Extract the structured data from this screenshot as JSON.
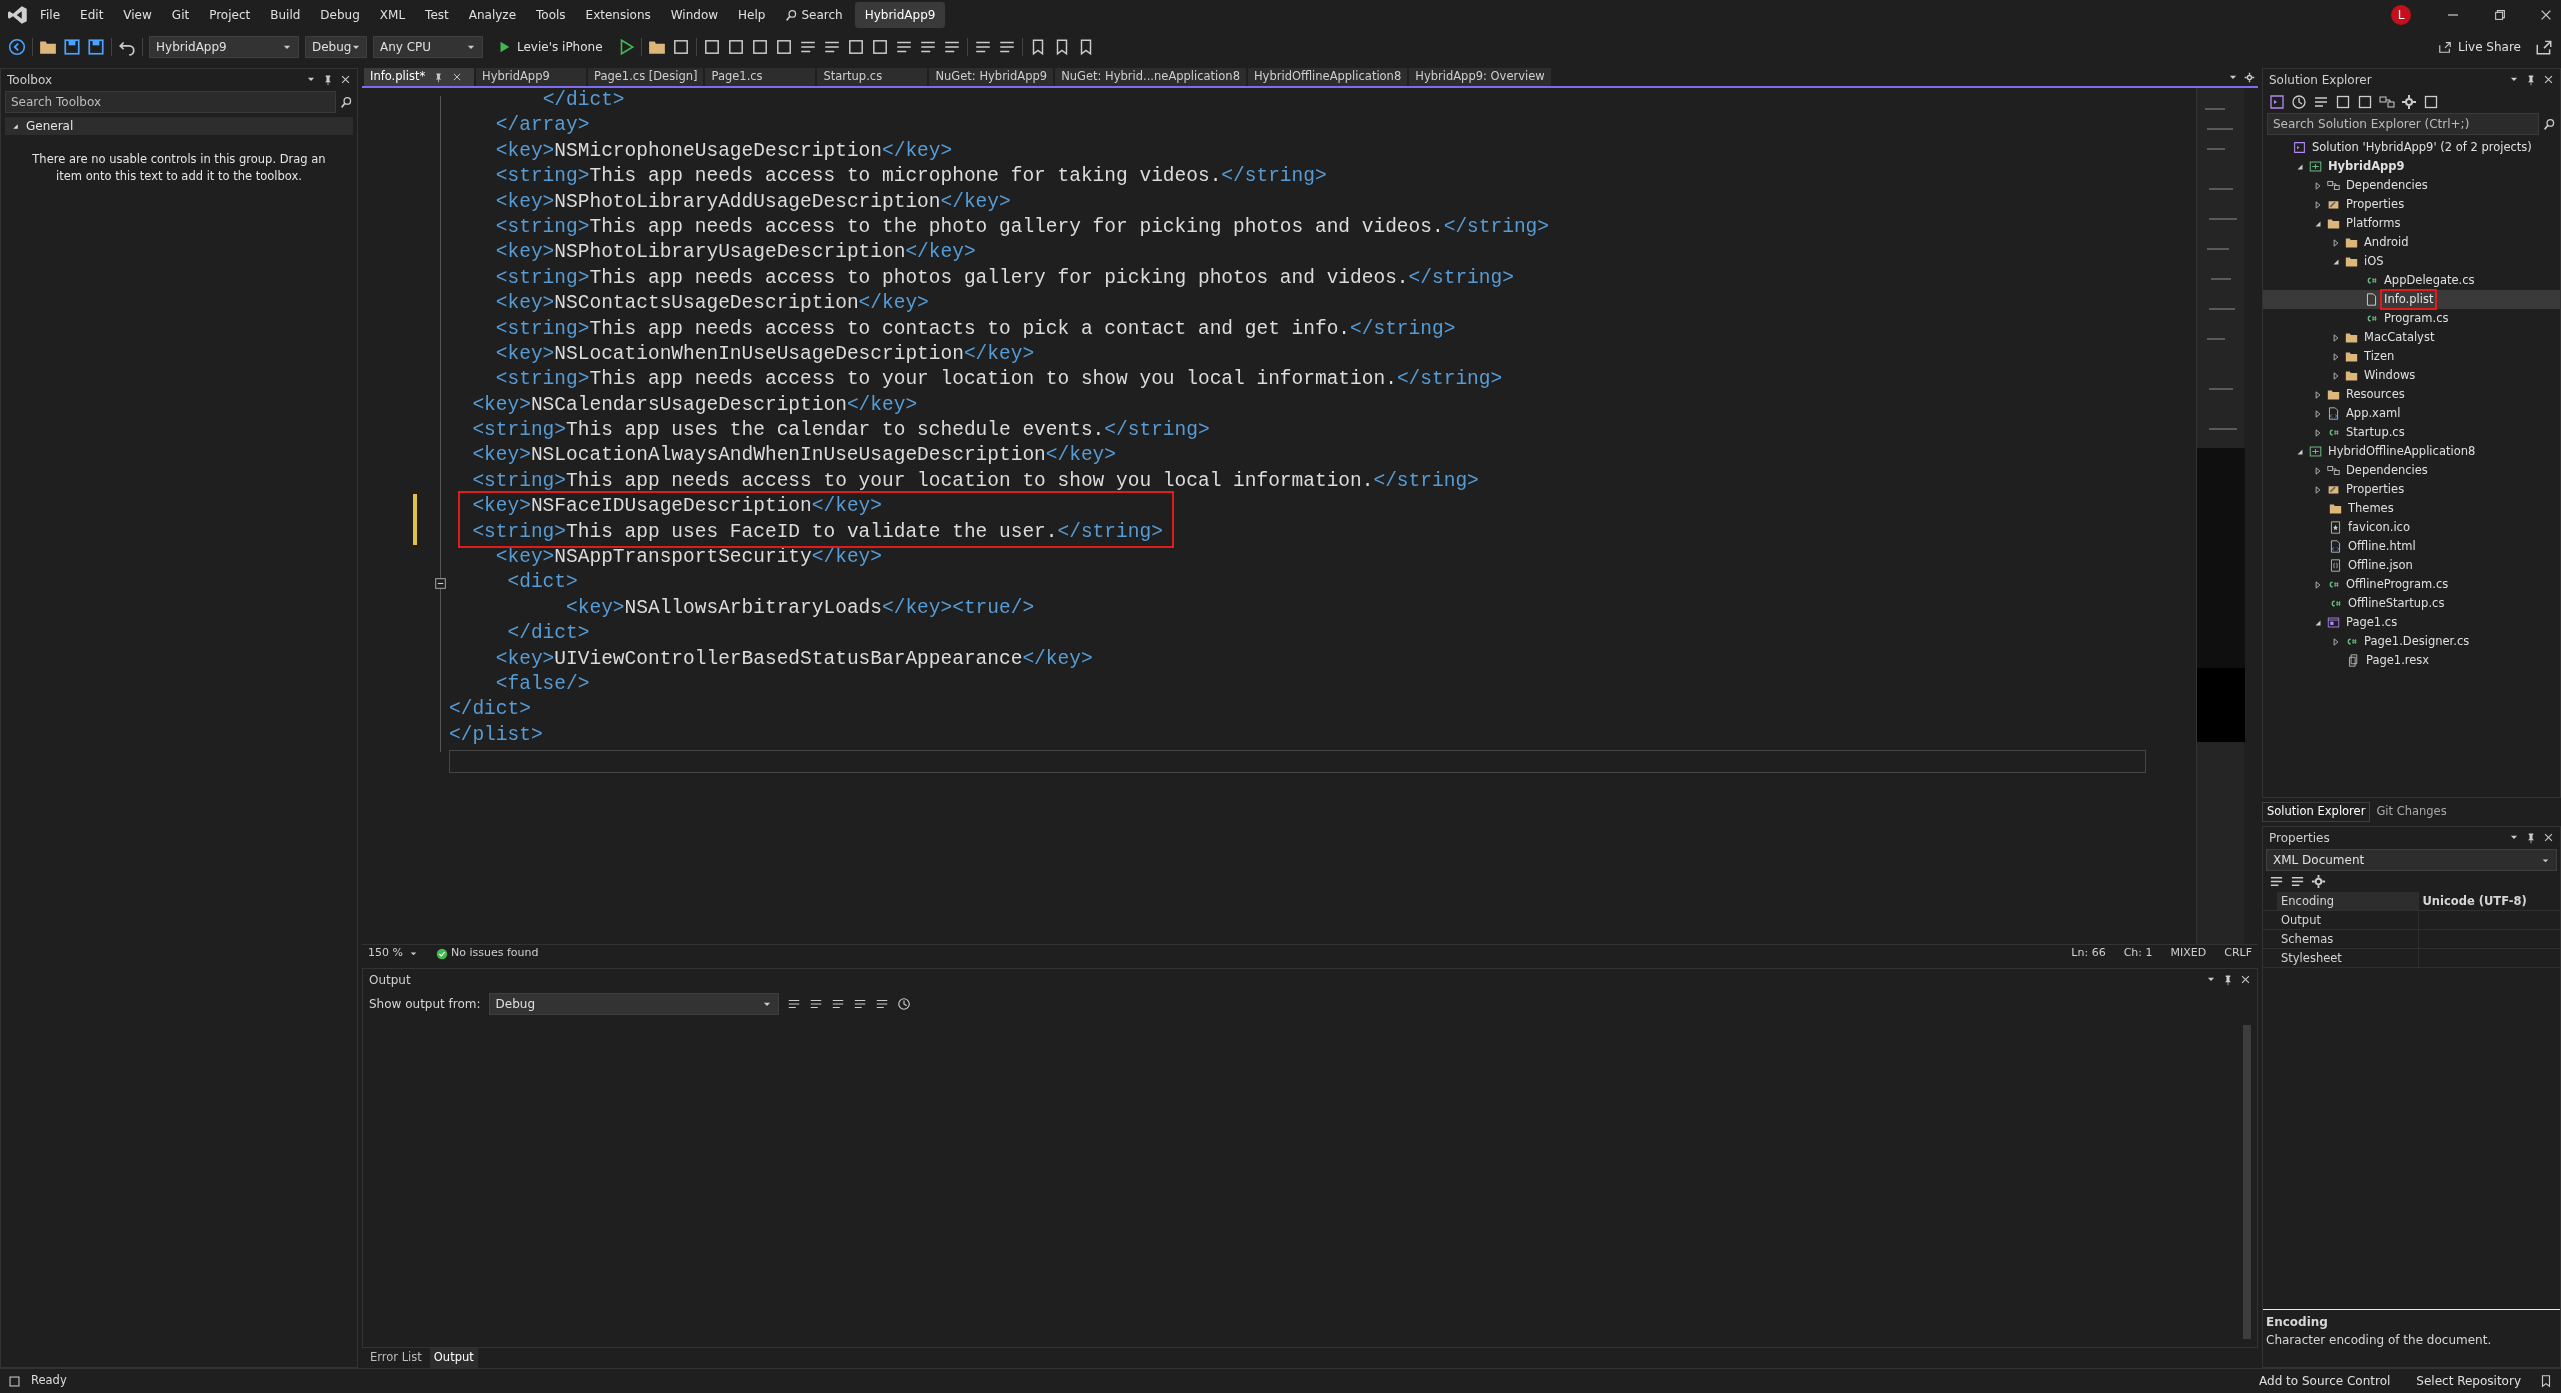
{
  "menu": {
    "items": [
      "File",
      "Edit",
      "View",
      "Git",
      "Project",
      "Build",
      "Debug",
      "XML",
      "Test",
      "Analyze",
      "Tools",
      "Extensions",
      "Window",
      "Help"
    ],
    "search": "Search",
    "solution_title": "HybridApp9",
    "avatar": "L"
  },
  "toolbar": {
    "project": "HybridApp9",
    "configuration": "Debug",
    "platform": "Any CPU",
    "run_target": "Levie's iPhone",
    "live_share": "Live Share"
  },
  "toolbox": {
    "title": "Toolbox",
    "search_placeholder": "Search Toolbox",
    "group": "General",
    "group_expanded": true,
    "empty_message": "There are no usable controls in this group. Drag an item onto this text to add it to the toolbox."
  },
  "tabs": [
    {
      "label": "Info.plist*",
      "selected": true
    },
    {
      "label": "HybridApp9",
      "selected": false
    },
    {
      "label": "Page1.cs [Design]",
      "selected": false
    },
    {
      "label": "Page1.cs",
      "selected": false
    },
    {
      "label": "Startup.cs",
      "selected": false
    },
    {
      "label": "NuGet: HybridApp9",
      "selected": false
    },
    {
      "label": "NuGet: Hybrid...neApplication8",
      "selected": false
    },
    {
      "label": "HybridOfflineApplication8",
      "selected": false
    },
    {
      "label": "HybridApp9: Overview",
      "selected": false
    }
  ],
  "editor": {
    "lines": [
      {
        "text": "        </dict>"
      },
      {
        "text": "    </array>"
      },
      {
        "text": "    <key>NSMicrophoneUsageDescription</key>"
      },
      {
        "text": "    <string>This app needs access to microphone for taking videos.</string>"
      },
      {
        "text": "    <key>NSPhotoLibraryAddUsageDescription</key>"
      },
      {
        "text": "    <string>This app needs access to the photo gallery for picking photos and videos.</string>"
      },
      {
        "text": "    <key>NSPhotoLibraryUsageDescription</key>"
      },
      {
        "text": "    <string>This app needs access to photos gallery for picking photos and videos.</string>"
      },
      {
        "text": "    <key>NSContactsUsageDescription</key>"
      },
      {
        "text": "    <string>This app needs access to contacts to pick a contact and get info.</string>"
      },
      {
        "text": "    <key>NSLocationWhenInUseUsageDescription</key>"
      },
      {
        "text": "    <string>This app needs access to your location to show you local information.</string>"
      },
      {
        "text": "  <key>NSCalendarsUsageDescription</key>"
      },
      {
        "text": "  <string>This app uses the calendar to schedule events.</string>"
      },
      {
        "text": "  <key>NSLocationAlwaysAndWhenInUseUsageDescription</key>"
      },
      {
        "text": "  <string>This app needs access to your location to show you local information.</string>"
      },
      {
        "text": "  <key>NSFaceIDUsageDescription</key>",
        "modified": true,
        "highlighted": true
      },
      {
        "text": "  <string>This app uses FaceID to validate the user.</string>",
        "modified": true,
        "highlighted": true
      },
      {
        "text": "    <key>NSAppTransportSecurity</key>"
      },
      {
        "text": "     <dict>",
        "foldable": true
      },
      {
        "text": "          <key>NSAllowsArbitraryLoads</key><true/>"
      },
      {
        "text": "     </dict>"
      },
      {
        "text": "    <key>UIViewControllerBasedStatusBarAppearance</key>"
      },
      {
        "text": "    <false/>"
      },
      {
        "text": "</dict>"
      },
      {
        "text": "</plist>"
      }
    ],
    "zoom": "150 %",
    "issues": "No issues found",
    "line": "Ln: 66",
    "column": "Ch: 1",
    "whitespace": "MIXED",
    "line_endings": "CRLF"
  },
  "output": {
    "title": "Output",
    "source_label": "Show output from:",
    "source": "Debug"
  },
  "bottom_tabs": [
    {
      "label": "Error List",
      "selected": false
    },
    {
      "label": "Output",
      "selected": true
    }
  ],
  "solution_explorer": {
    "title": "Solution Explorer",
    "search_placeholder": "Search Solution Explorer (Ctrl+;)",
    "tree": [
      {
        "label": "Solution 'HybridApp9' (2 of 2 projects)",
        "kind": "solution",
        "selected": false,
        "children": [
          {
            "label": "HybridApp9",
            "kind": "project",
            "startup": true,
            "expanded": true,
            "selected": false,
            "children": [
              {
                "label": "Dependencies",
                "kind": "dependencies",
                "expanded": false,
                "selected": false
              },
              {
                "label": "Properties",
                "kind": "properties",
                "expanded": false,
                "selected": false
              },
              {
                "label": "Platforms",
                "kind": "folder",
                "expanded": true,
                "selected": false,
                "children": [
                  {
                    "label": "Android",
                    "kind": "folder",
                    "expanded": false,
                    "selected": false
                  },
                  {
                    "label": "iOS",
                    "kind": "folder",
                    "expanded": true,
                    "selected": false,
                    "children": [
                      {
                        "label": "AppDelegate.cs",
                        "kind": "csharp",
                        "selected": false
                      },
                      {
                        "label": "Info.plist",
                        "kind": "file",
                        "selected": true,
                        "highlighted": true
                      },
                      {
                        "label": "Program.cs",
                        "kind": "csharp",
                        "selected": false
                      }
                    ]
                  },
                  {
                    "label": "MacCatalyst",
                    "kind": "folder",
                    "expanded": false,
                    "selected": false
                  },
                  {
                    "label": "Tizen",
                    "kind": "folder",
                    "expanded": false,
                    "selected": false
                  },
                  {
                    "label": "Windows",
                    "kind": "folder",
                    "expanded": false,
                    "selected": false
                  }
                ]
              },
              {
                "label": "Resources",
                "kind": "folder",
                "expanded": false,
                "selected": false
              },
              {
                "label": "App.xaml",
                "kind": "markup",
                "expanded": false,
                "selected": false
              },
              {
                "label": "Startup.cs",
                "kind": "csharp",
                "expanded": false,
                "selected": false
              }
            ]
          },
          {
            "label": "HybridOfflineApplication8",
            "kind": "project",
            "startup": false,
            "expanded": true,
            "selected": false,
            "children": [
              {
                "label": "Dependencies",
                "kind": "dependencies",
                "expanded": false,
                "selected": false
              },
              {
                "label": "Properties",
                "kind": "properties",
                "expanded": false,
                "selected": false
              },
              {
                "label": "Themes",
                "kind": "folder",
                "selected": false
              },
              {
                "label": "favicon.ico",
                "kind": "image",
                "selected": false
              },
              {
                "label": "Offline.html",
                "kind": "markup",
                "selected": false
              },
              {
                "label": "Offline.json",
                "kind": "json",
                "selected": false
              },
              {
                "label": "OfflineProgram.cs",
                "kind": "csharp",
                "expanded": false,
                "selected": false
              },
              {
                "label": "OfflineStartup.cs",
                "kind": "csharp",
                "selected": false
              },
              {
                "label": "Page1.cs",
                "kind": "form",
                "expanded": true,
                "selected": false,
                "children": [
                  {
                    "label": "Page1.Designer.cs",
                    "kind": "csharp",
                    "expanded": false,
                    "selected": false
                  },
                  {
                    "label": "Page1.resx",
                    "kind": "resource",
                    "selected": false
                  }
                ]
              }
            ]
          }
        ]
      }
    ]
  },
  "right_tabs": [
    {
      "label": "Solution Explorer",
      "selected": true
    },
    {
      "label": "Git Changes",
      "selected": false
    }
  ],
  "properties": {
    "title": "Properties",
    "object": "XML Document",
    "rows": [
      {
        "name": "Encoding",
        "value": "Unicode (UTF-8)",
        "selected": true
      },
      {
        "name": "Output",
        "selected": false
      },
      {
        "name": "Schemas",
        "selected": false
      },
      {
        "name": "Stylesheet",
        "selected": false
      }
    ],
    "description_title": "Encoding",
    "description": "Character encoding of the document."
  },
  "status_bar": {
    "state": "Ready",
    "source_control": "Add to Source Control",
    "repository": "Select Repository"
  }
}
